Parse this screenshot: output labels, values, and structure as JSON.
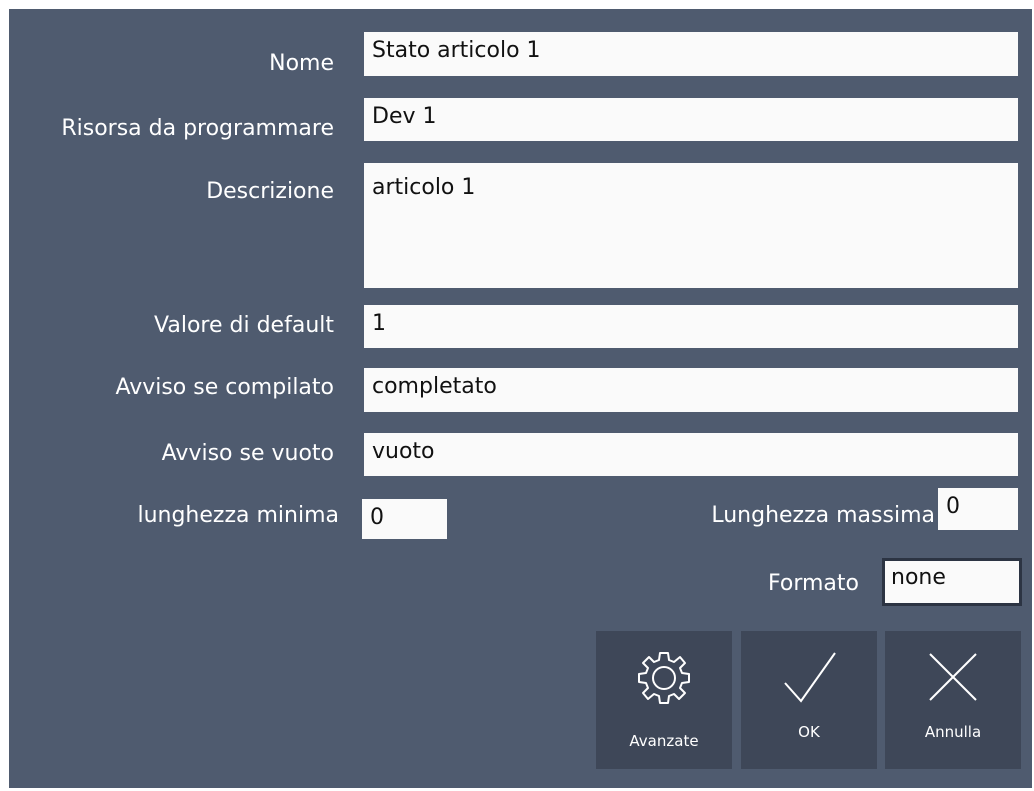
{
  "form": {
    "nome": {
      "label": "Nome",
      "value": "Stato articolo 1"
    },
    "risorsa": {
      "label": "Risorsa da programmare",
      "value": "Dev 1"
    },
    "descrizione": {
      "label": "Descrizione",
      "value": "articolo 1"
    },
    "default": {
      "label": "Valore di default",
      "value": "1"
    },
    "avviso_compilato": {
      "label": "Avviso se compilato",
      "value": "completato"
    },
    "avviso_vuoto": {
      "label": "Avviso se vuoto",
      "value": "vuoto"
    },
    "lunghezza_minima": {
      "label": "lunghezza minima",
      "value": "0"
    },
    "lunghezza_massima": {
      "label": "Lunghezza massima",
      "value": "0"
    },
    "formato": {
      "label": "Formato",
      "value": "none"
    }
  },
  "buttons": {
    "avanzate": {
      "label": "Avanzate",
      "icon": "gear-icon"
    },
    "ok": {
      "label": "OK",
      "icon": "check-icon"
    },
    "annulla": {
      "label": "Annulla",
      "icon": "close-icon"
    }
  },
  "colors": {
    "panel_bg": "#4f5b6f",
    "button_bg": "#3e4758",
    "field_bg": "#fafafa"
  }
}
